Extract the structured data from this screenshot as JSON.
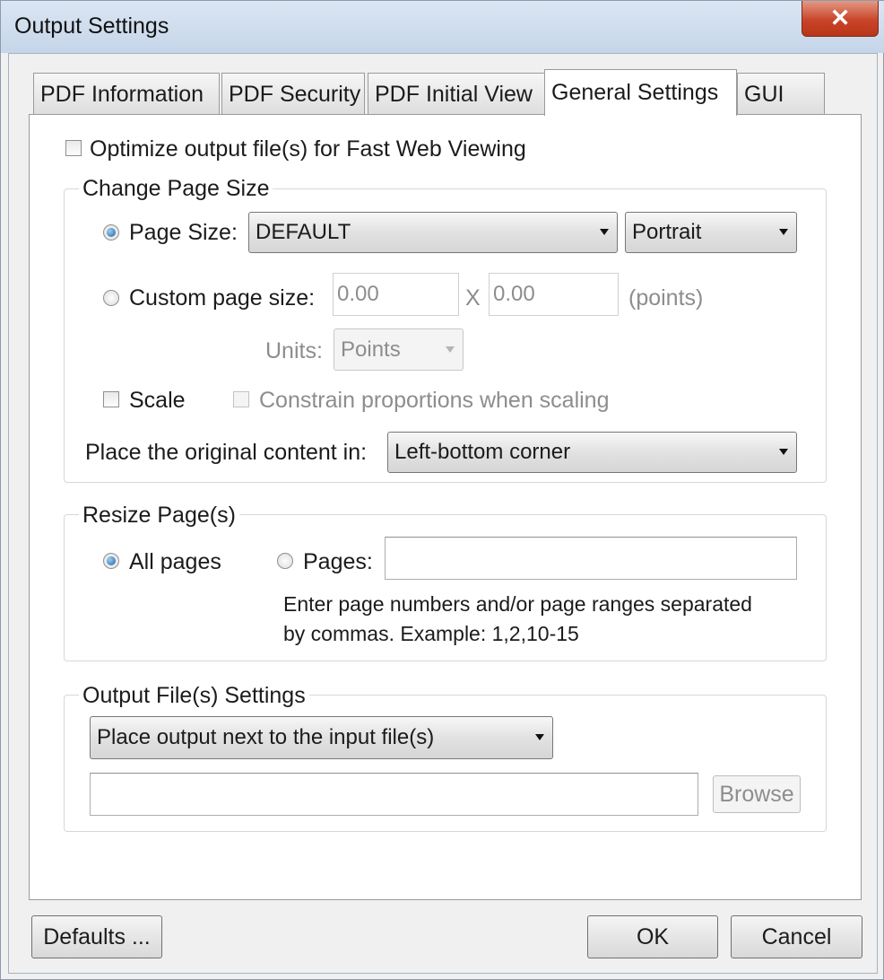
{
  "window": {
    "title": "Output Settings",
    "close_glyph": "✕"
  },
  "tabs": [
    {
      "label": "PDF Information"
    },
    {
      "label": "PDF Security"
    },
    {
      "label": "PDF Initial View"
    },
    {
      "label": "General Settings",
      "active": true
    },
    {
      "label": "GUI"
    }
  ],
  "optimize": {
    "label": "Optimize output file(s) for Fast Web Viewing",
    "checked": false
  },
  "change_page_size": {
    "title": "Change Page Size",
    "page_size_label": "Page Size:",
    "page_size_value": "DEFAULT",
    "orientation_value": "Portrait",
    "custom_label": "Custom page size:",
    "width_value": "0.00",
    "x_label": "X",
    "height_value": "0.00",
    "points_label": "(points)",
    "units_label": "Units:",
    "units_value": "Points",
    "scale_label": "Scale",
    "constrain_label": "Constrain proportions when scaling",
    "place_label": "Place the original content in:",
    "place_value": "Left-bottom corner"
  },
  "resize": {
    "title": "Resize Page(s)",
    "all_label": "All pages",
    "pages_label": "Pages:",
    "pages_value": "",
    "hint_line1": "Enter page numbers and/or page ranges separated",
    "hint_line2": "by commas. Example: 1,2,10-15"
  },
  "output": {
    "title": "Output File(s) Settings",
    "mode_value": "Place output next to the input file(s)",
    "path_value": "",
    "browse_label": "Browse"
  },
  "footer": {
    "defaults_label": "Defaults ...",
    "ok_label": "OK",
    "cancel_label": "Cancel"
  },
  "colors": {
    "title_bar": "#c9d8ea",
    "close_button": "#c8452a",
    "radio_selected": "#1f5fa3"
  }
}
